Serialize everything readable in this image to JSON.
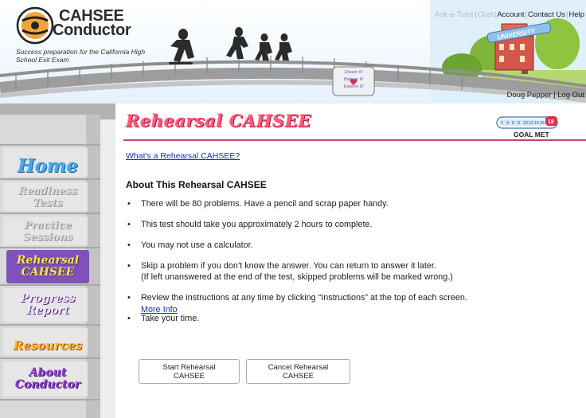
{
  "header": {
    "brand_line1": "CAHSEE",
    "brand_line2": "Conductor",
    "tagline": "Success preparation for the California High School Exit Exam",
    "top_links": [
      {
        "label": "Ask-a-Tutor",
        "enabled": false
      },
      {
        "label": "Chat",
        "enabled": false
      },
      {
        "label": "Account",
        "enabled": true
      },
      {
        "label": "Contact Us",
        "enabled": true
      },
      {
        "label": "Help",
        "enabled": true
      }
    ],
    "user_name": "Doug Pepper",
    "logout_label": "Log Out",
    "banner_sign_text": "UNIVERSITY",
    "bridge_sign_text": "Dream It! Believe It! Explore It!"
  },
  "sidebar": {
    "items": [
      {
        "id": "home",
        "label": "Home",
        "state": "normal"
      },
      {
        "id": "readiness",
        "label_line1": "Readiness",
        "label_line2": "Tests",
        "state": "disabled"
      },
      {
        "id": "practice",
        "label_line1": "Practice",
        "label_line2": "Sessions",
        "state": "disabled"
      },
      {
        "id": "rehearsal",
        "label_line1": "Rehearsal",
        "label_line2": "CAHSEE",
        "state": "active"
      },
      {
        "id": "progress",
        "label_line1": "Progress",
        "label_line2": "Report",
        "state": "normal"
      },
      {
        "id": "resources",
        "label": "Resources",
        "state": "normal"
      },
      {
        "id": "about",
        "label_line1": "About",
        "label_line2": "Conductor",
        "state": "normal"
      }
    ]
  },
  "main": {
    "title": "Rehearsal CAHSEE",
    "goal_meter": {
      "ticks": [
        "2",
        "4",
        "6",
        "8",
        "10",
        "12",
        "14",
        "16"
      ],
      "current_value": "18",
      "label": "GOAL MET"
    },
    "whats_link": "What's a Rehearsal CAHSEE?",
    "about_heading": "About This Rehearsal CAHSEE",
    "bullets": [
      {
        "text": "There will be 80 problems.  Have a pencil and scrap paper handy."
      },
      {
        "text": "This test should take you approximately 2 hours to complete."
      },
      {
        "text": "You may not use a calculator."
      },
      {
        "text": "Skip a problem if you don’t know the answer. You can return to answer it later.",
        "line2": "(If left unanswered at the end of the test, skipped problems will be marked wrong.)"
      },
      {
        "text": "Review the instructions at any time by clicking “Instructions” at the top of each screen."
      },
      {
        "text": "Take your time."
      }
    ],
    "more_info_link": "More Info",
    "start_button": "Start Rehearsal CAHSEE",
    "cancel_button": "Cancel Rehearsal CAHSEE"
  },
  "colors": {
    "title_pink": "#ff5a7a",
    "rule": "#c8416b",
    "link_blue": "#1a2bb8",
    "active_nav_purple": "#7e52ba",
    "goal_badge_red": "#d8324b"
  }
}
